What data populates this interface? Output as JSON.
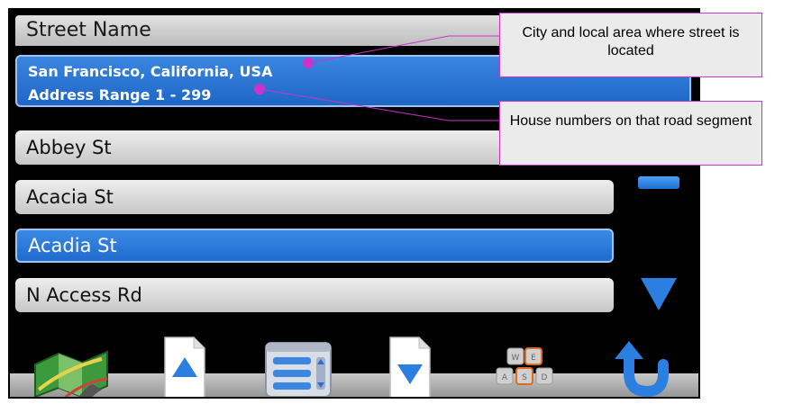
{
  "header": {
    "title": "Street Name"
  },
  "location": {
    "city": "San Francisco, California, USA",
    "address_range": "Address Range 1 - 299"
  },
  "streets": [
    {
      "label": "Abbey St",
      "selected": false
    },
    {
      "label": "Acacia St",
      "selected": false
    },
    {
      "label": "Acadia St",
      "selected": true
    },
    {
      "label": "N Access Rd",
      "selected": false
    }
  ],
  "toolbar": {
    "buttons": [
      "map-icon",
      "page-up-icon",
      "list-view-icon",
      "page-down-icon",
      "keyboard-icon",
      "back-icon"
    ],
    "keyboard_keys": [
      "W",
      "E",
      "A",
      "S",
      "D"
    ]
  },
  "callouts": {
    "city_note": "City and local area where street is located",
    "range_note": "House numbers on that road segment"
  },
  "colors": {
    "accent": "#1f6bcf",
    "callout_border": "#cc33cc",
    "background": "#000000"
  }
}
